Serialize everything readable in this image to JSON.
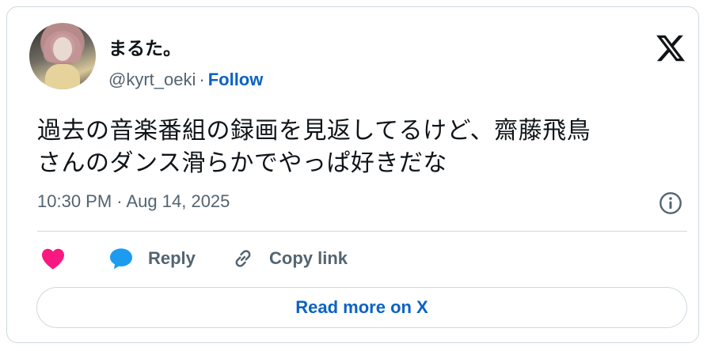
{
  "author": {
    "display_name": "まるた。",
    "handle": "@kyrt_oeki",
    "separator": "·",
    "follow_label": "Follow"
  },
  "tweet": {
    "text_line1": "過去の音楽番組の録画を見返してるけど、齋藤飛鳥",
    "text_line2": "さんのダンス滑らかでやっぱ好きだな",
    "timestamp": "10:30 PM · Aug 14, 2025"
  },
  "actions": {
    "reply_label": "Reply",
    "copy_link_label": "Copy link",
    "read_more_label": "Read more on X"
  },
  "colors": {
    "link_blue": "#0b62c6",
    "heart_pink": "#f91880",
    "reply_blue": "#1d9bf0",
    "muted_text": "#536471",
    "border": "#cfd9de"
  },
  "icons": [
    "x-logo-icon",
    "info-icon",
    "heart-icon",
    "reply-bubble-icon",
    "link-icon"
  ]
}
